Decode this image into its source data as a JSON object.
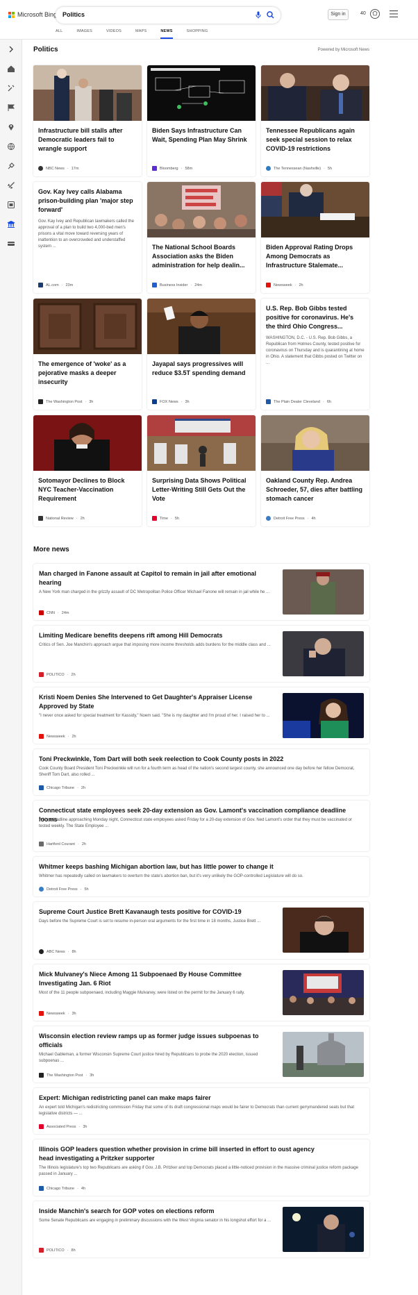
{
  "header": {
    "logo_text": "Microsoft Bing",
    "search_value": "Politics",
    "signin_label": "Sign in",
    "points": "40",
    "tabs": [
      "ALL",
      "IMAGES",
      "VIDEOS",
      "MAPS",
      "NEWS",
      "SHOPPING"
    ],
    "active_tab": "NEWS"
  },
  "section": {
    "title": "Politics",
    "powered_by": "Powered by Microsoft News"
  },
  "cards": [
    {
      "title": "Infrastructure bill stalls after Democratic leaders fail to wrangle support",
      "desc": "",
      "source": "NBC News",
      "time": "17m"
    },
    {
      "title": "Biden Says Infrastructure Can Wait, Spending Plan May Shrink",
      "desc": "",
      "source": "Bloomberg",
      "time": "58m"
    },
    {
      "title": "Tennessee Republicans again seek special session to relax COVID-19 restrictions",
      "desc": "",
      "source": "The Tennessean (Nashville)",
      "time": "5h"
    },
    {
      "title": "Gov. Kay Ivey calls Alabama prison-building plan 'major step forward'",
      "desc": "Gov. Kay Ivey and Republican lawmakers called the approval of a plan to build two 4,000-bed men's prisons a vital move toward reversing years of inattention to an overcrowded and understaffed system ...",
      "source": "AL.com",
      "time": "23m"
    },
    {
      "title": "The National School Boards Association asks the Biden administration for help dealin...",
      "desc": "",
      "source": "Business Insider",
      "time": "24m"
    },
    {
      "title": "Biden Approval Rating Drops Among Democrats as Infrastructure Stalemate...",
      "desc": "",
      "source": "Newsweek",
      "time": "2h"
    },
    {
      "title": "The emergence of 'woke' as a pejorative masks a deeper insecurity",
      "desc": "",
      "source": "The Washington Post",
      "time": "3h"
    },
    {
      "title": "Jayapal says progressives will reduce $3.5T spending demand",
      "desc": "",
      "source": "FOX News",
      "time": "3h"
    },
    {
      "title": "U.S. Rep. Bob Gibbs tested positive for coronavirus. He's the third Ohio Congress...",
      "desc": "WASHINGTON, D.C. - U.S. Rep. Bob Gibbs, a Republican from Holmes County, tested positive for coronavirus on Thursday and is quarantining at home in Ohio. A statement that Gibbs posted on Twitter on ...",
      "source": "The Plain Dealer Cleveland",
      "time": "6h"
    },
    {
      "title": "Sotomayor Declines to Block NYC Teacher-Vaccination Requirement",
      "desc": "",
      "source": "National Review",
      "time": "2h"
    },
    {
      "title": "Surprising Data Shows Political Letter-Writing Still Gets Out the Vote",
      "desc": "",
      "source": "Time",
      "time": "5h"
    },
    {
      "title": "Oakland County Rep. Andrea Schroeder, 57, dies after battling stomach cancer",
      "desc": "",
      "source": "Detroit Free Press",
      "time": "4h"
    }
  ],
  "more_news_title": "More news",
  "more_news": [
    {
      "title": "Man charged in Fanone assault at Capitol to remain in jail after emotional hearing",
      "desc": "A New York man charged in the grizzly assault of DC Metropolitan Police Officer Michael Fanone will remain in jail while he ...",
      "source": "CNN",
      "time": "24m"
    },
    {
      "title": "Limiting Medicare benefits deepens rift among Hill Democrats",
      "desc": "Critics of Sen. Joe Manchin's approach argue that imposing more income thresholds adds burdens for the middle class and ...",
      "source": "POLITICO",
      "time": "2h"
    },
    {
      "title": "Kristi Noem Denies She Intervened to Get Daughter's Appraiser License Approved by State",
      "desc": "\"I never once asked for special treatment for Kassidy,\" Noem said. \"She is my daughter and I'm proud of her. I raised her to ...",
      "source": "Newsweek",
      "time": "2h"
    },
    {
      "title": "Toni Preckwinkle, Tom Dart will both seek reelection to Cook County posts in 2022",
      "desc": "Cook County Board President Toni Preckwinkle will run for a fourth term as head of the nation's second largest county, she announced one day before her fellow Democrat, Sheriff Tom Dart, also rolled ...",
      "source": "Chicago Tribune",
      "time": "2h"
    },
    {
      "title": "Connecticut state employees seek 20-day extension as Gov. Lamont's vaccination compliance deadline looms",
      "desc": "With a deadline approaching Monday night, Connecticut state employees asked Friday for a 20-day extension of Gov. Ned Lamont's order that they must be vaccinated or tested weekly. The State Employee ...",
      "source": "Hartford Courant",
      "time": "2h"
    },
    {
      "title": "Whitmer keeps bashing Michigan abortion law, but has little power to change it",
      "desc": "Whitmer has repeatedly called on lawmakers to overturn the state's abortion ban, but it's very unlikely the GOP-controlled Legislature will do so.",
      "source": "Detroit Free Press",
      "time": "5h"
    },
    {
      "title": "Supreme Court Justice Brett Kavanaugh tests positive for COVID-19",
      "desc": "Days before the Supreme Court is set to resume in-person oral arguments for the first time in 18 months, Justice Brett ...",
      "source": "ABC News",
      "time": "8h"
    },
    {
      "title": "Mick Mulvaney's Niece Among 11 Subpoenaed By House Committee Investigating Jan. 6 Riot",
      "desc": "Most of the 11 people subpoenaed, including Maggie Mulvaney, were listed on the permit for the January 6 rally.",
      "source": "Newsweek",
      "time": "3h"
    },
    {
      "title": "Wisconsin election review ramps up as former judge issues subpoenas to officials",
      "desc": "Michael Gableman, a former Wisconsin Supreme Court justice hired by Republicans to probe the 2020 election, issued subpoenas ...",
      "source": "The Washington Post",
      "time": "3h"
    },
    {
      "title": "Expert: Michigan redistricting panel can make maps fairer",
      "desc": "An expert told Michigan's redistricting commission Friday that some of its draft congressional maps would be fairer to Democrats than current gerrymandered seats but that legislative districts — ...",
      "source": "Associated Press",
      "time": "3h"
    },
    {
      "title": "Illinois GOP leaders question whether provision in crime bill inserted in effort to oust agency head investigating a Pritzker supporter",
      "desc": "The Illinois legislature's top two Republicans are asking if Gov. J.B. Pritzker and top Democrats placed a little-noticed provision in the massive criminal justice reform package passed in January ...",
      "source": "Chicago Tribune",
      "time": "4h"
    },
    {
      "title": "Inside Manchin's search for GOP votes on elections reform",
      "desc": "Some Senate Republicans are engaging in preliminary discussions with the West Virginia senator in his longshot effort for a ...",
      "source": "POLITICO",
      "time": "8h"
    }
  ],
  "colors": {
    "accent": "#174ae4",
    "cnn": "#cc0000",
    "politico": "#d4202a",
    "newsweek": "#e3120b"
  },
  "icons": [
    "microsoft-logo",
    "mic-icon",
    "search-icon",
    "rewards-icon",
    "menu-icon",
    "expand-icon",
    "home-icon",
    "tools-icon",
    "flag-icon",
    "location-icon",
    "globe-icon",
    "sports-icon",
    "rocket-icon",
    "entertainment-icon",
    "politics-icon",
    "money-icon"
  ]
}
